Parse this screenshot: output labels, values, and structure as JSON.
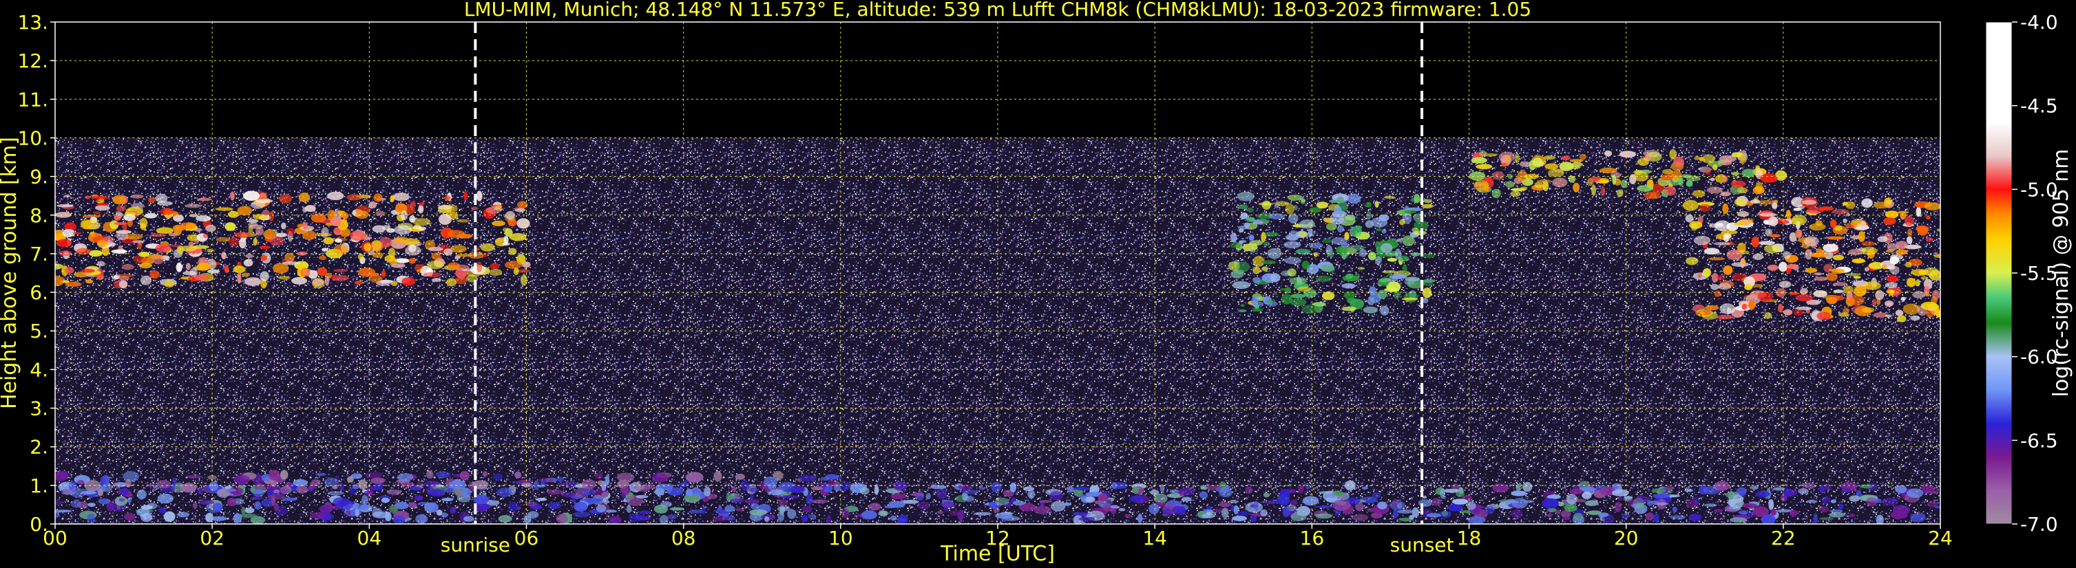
{
  "chart_data": {
    "type": "heatmap",
    "title": "LMU-MIM, Munich; 48.148° N 11.573° E, altitude: 539 m    Lufft CHM8k (CHM8kLMU): 18-03-2023    firmware: 1.05",
    "xlabel": "Time [UTC]",
    "ylabel": "Height above ground [km]",
    "xlim": [
      0,
      24
    ],
    "ylim": [
      0,
      13
    ],
    "x_ticks": [
      "00",
      "02",
      "04",
      "06",
      "08",
      "10",
      "12",
      "14",
      "16",
      "18",
      "20",
      "22",
      "24"
    ],
    "y_ticks": [
      "0.",
      "1.",
      "2.",
      "3.",
      "4.",
      "5.",
      "6.",
      "7.",
      "8.",
      "9.",
      "10.",
      "11.",
      "12.",
      "13."
    ],
    "grid": true,
    "data_top_km": 10,
    "markers": [
      {
        "label": "sunrise",
        "x": 5.35
      },
      {
        "label": "sunset",
        "x": 17.4
      }
    ],
    "colorbar": {
      "label": "log(rc-signal) @ 905 nm",
      "range": [
        -7.0,
        -4.0
      ],
      "ticks": [
        "-4.0",
        "-4.5",
        "-5.0",
        "-5.5",
        "-6.0",
        "-6.5",
        "-7.0"
      ],
      "tick_values": [
        -4.0,
        -4.5,
        -5.0,
        -5.5,
        -6.0,
        -6.5,
        -7.0
      ],
      "stops": [
        {
          "v": -7.0,
          "c": "#a08ca0"
        },
        {
          "v": -6.8,
          "c": "#9a5fa8"
        },
        {
          "v": -6.6,
          "c": "#7a1a90"
        },
        {
          "v": -6.4,
          "c": "#2a22d8"
        },
        {
          "v": -6.2,
          "c": "#6f96f5"
        },
        {
          "v": -6.0,
          "c": "#a9c2f5"
        },
        {
          "v": -5.8,
          "c": "#1a8a1a"
        },
        {
          "v": -5.65,
          "c": "#48c878"
        },
        {
          "v": -5.5,
          "c": "#d8f050"
        },
        {
          "v": -5.3,
          "c": "#ffd000"
        },
        {
          "v": -5.15,
          "c": "#ff8a00"
        },
        {
          "v": -5.0,
          "c": "#ff1010"
        },
        {
          "v": -4.8,
          "c": "#e8c8c8"
        },
        {
          "v": -4.6,
          "c": "#ffffff"
        },
        {
          "v": -4.0,
          "c": "#ffffff"
        }
      ]
    },
    "features": [
      {
        "name": "boundary-layer",
        "x": [
          0,
          24
        ],
        "y": [
          0.1,
          1.0
        ],
        "level": -6.3
      },
      {
        "name": "residual-layer",
        "x": [
          0,
          10
        ],
        "y": [
          0.8,
          1.3
        ],
        "level": -6.6
      },
      {
        "name": "morning-cloud",
        "x": [
          0,
          6
        ],
        "y": [
          6.2,
          8.5
        ],
        "level": -5.0
      },
      {
        "name": "evening-cirrus-high",
        "x": [
          18,
          22
        ],
        "y": [
          8.5,
          9.6
        ],
        "level": -5.2
      },
      {
        "name": "night-cloud",
        "x": [
          20.8,
          24
        ],
        "y": [
          5.3,
          8.4
        ],
        "level": -5.0
      },
      {
        "name": "fall-streaks",
        "x": [
          15,
          17.5
        ],
        "y": [
          5.5,
          8.5
        ],
        "level": -5.8
      }
    ]
  }
}
